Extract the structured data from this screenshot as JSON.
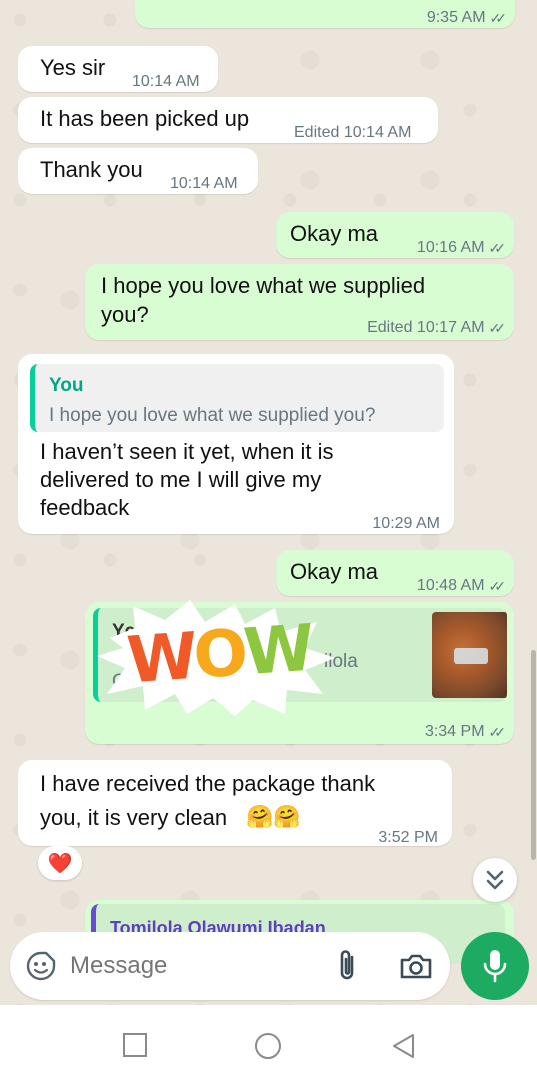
{
  "messages": {
    "m0": {
      "time": "9:35 AM"
    },
    "m1": {
      "text": "Yes sir",
      "time": "10:14 AM"
    },
    "m2": {
      "text": "It has been picked  up",
      "time": "Edited 10:14 AM"
    },
    "m3": {
      "text": "Thank you",
      "time": "10:14 AM"
    },
    "m4": {
      "text": "Okay ma",
      "time": "10:16 AM"
    },
    "m5": {
      "line1": "I hope you love what we supplied",
      "line2": "you?",
      "time": "Edited 10:17 AM"
    },
    "m6": {
      "quote_name": "You",
      "quote_text": "I hope you love what we supplied you?",
      "line1": "I haven’t seen it yet, when it is",
      "line2": "delivered to me I will give my",
      "line3": "feedback",
      "time": "10:29 AM"
    },
    "m7": {
      "text": "Okay ma",
      "time": "10:48 AM"
    },
    "m8": {
      "quote_name_partial": "Yc",
      "quote_text_partial": "O.",
      "quote_text_right": "ilola",
      "sticker_text": "WOW",
      "time": "3:34 PM"
    },
    "m9": {
      "line1": "I have received the package thank",
      "line2": "you, it is very clean",
      "emoji": "🤗🤗",
      "time": "3:52 PM",
      "reaction": "❤️"
    },
    "m10": {
      "quote_name": "Tomilola Olawumi Ibadan"
    }
  },
  "composer": {
    "placeholder": "Message"
  },
  "icons": {
    "sticker": "sticker-icon",
    "attach": "paperclip-icon",
    "camera": "camera-icon",
    "mic": "microphone-icon",
    "scroll_down": "double-chevron-down-icon",
    "nav_recent": "square-icon",
    "nav_home": "circle-icon",
    "nav_back": "triangle-back-icon"
  },
  "colors": {
    "outgoing_bubble": "#d9fdd3",
    "incoming_bubble": "#ffffff",
    "accent_green": "#1daa61",
    "quote_name_green": "#00a884"
  }
}
